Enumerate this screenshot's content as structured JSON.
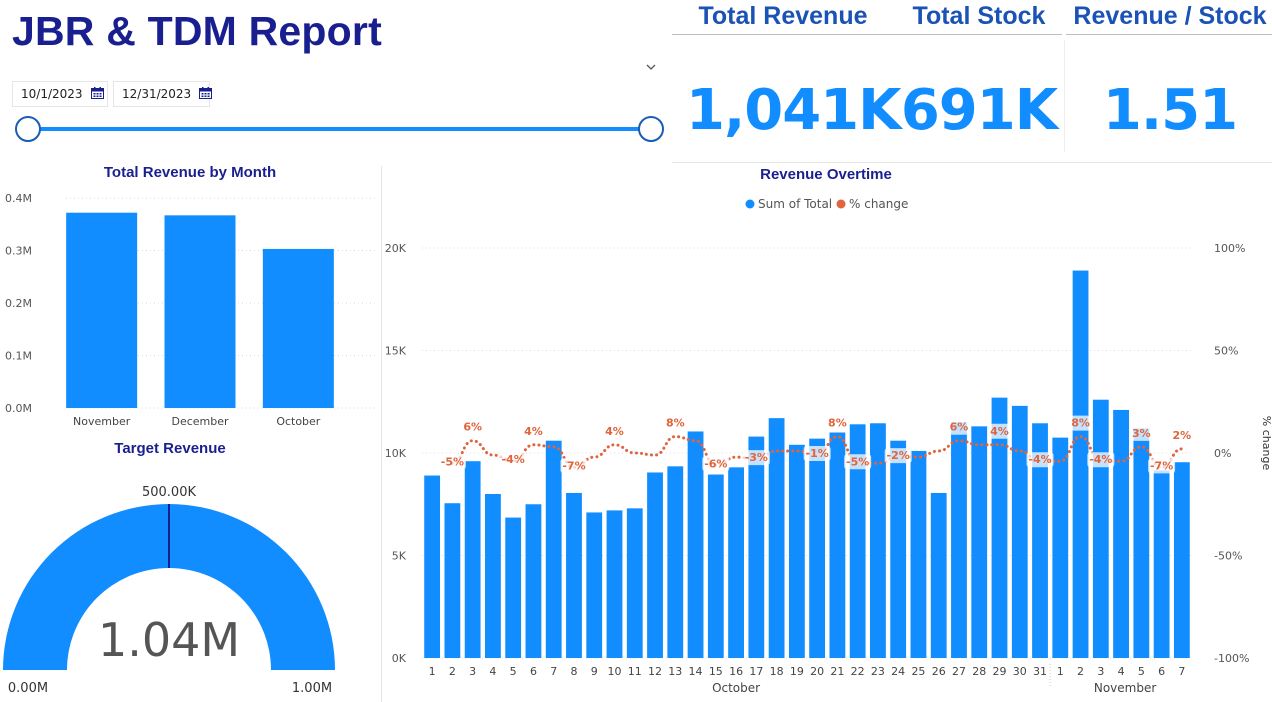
{
  "report": {
    "title": "JBR & TDM Report",
    "date_start": "10/1/2023",
    "date_end": "12/31/2023"
  },
  "icons": {
    "calendar": "calendar-icon",
    "chevron": "chevron-down-icon"
  },
  "colors": {
    "title": "#1a1f8f",
    "kpi_header": "#1a52b5",
    "accent": "#118dff",
    "change_line": "#e0643c"
  },
  "kpis": [
    {
      "label": "Total Revenue",
      "value": "1,041K"
    },
    {
      "label": "Total Stock",
      "value": "691K"
    },
    {
      "label": "Revenue / Stock",
      "value": "1.51"
    }
  ],
  "monthly": {
    "title": "Total Revenue by Month"
  },
  "gauge": {
    "title": "Target Revenue",
    "value_label": "1.04M",
    "min_label": "0.00M",
    "max_label": "1.00M",
    "target_label": "500.00K",
    "value": 1.04,
    "min": 0,
    "max": 1.0,
    "target": 0.5
  },
  "overtime": {
    "title": "Revenue Overtime"
  },
  "chart_data": [
    {
      "type": "bar",
      "title": "Total Revenue by Month",
      "categories": [
        "November",
        "December",
        "October"
      ],
      "values": [
        0.372,
        0.367,
        0.303
      ],
      "y_ticks": [
        "0.0M",
        "0.1M",
        "0.2M",
        "0.3M",
        "0.4M"
      ],
      "ylim": [
        0,
        0.4
      ],
      "grid": true
    },
    {
      "type": "bar",
      "title": "Revenue Overtime",
      "legend": [
        "Sum of Total",
        "% change"
      ],
      "legend_position": "top-center",
      "x_days": [
        "1",
        "2",
        "3",
        "4",
        "5",
        "6",
        "7",
        "8",
        "9",
        "10",
        "11",
        "12",
        "13",
        "14",
        "15",
        "16",
        "17",
        "18",
        "19",
        "20",
        "21",
        "22",
        "23",
        "24",
        "25",
        "26",
        "27",
        "28",
        "29",
        "30",
        "31",
        "1",
        "2",
        "3",
        "4",
        "5",
        "6",
        "7"
      ],
      "month_labels": [
        "October",
        "November"
      ],
      "series": [
        {
          "name": "Sum of Total",
          "axis": "left",
          "values": [
            8900,
            7550,
            9600,
            8000,
            6850,
            7500,
            10600,
            8050,
            7100,
            7200,
            7300,
            9050,
            9350,
            11050,
            8950,
            9300,
            10800,
            11700,
            10400,
            10700,
            11000,
            11400,
            11450,
            10600,
            10100,
            8050,
            11500,
            11300,
            12700,
            12300,
            11450,
            10750,
            18900,
            12600,
            12100,
            11200,
            9150,
            9550
          ]
        },
        {
          "name": "% change",
          "type": "line",
          "axis": "right",
          "values": [
            null,
            -5,
            6,
            -1,
            -4,
            4,
            3,
            -7,
            -2,
            4,
            0,
            -1,
            8,
            6,
            -6,
            -2,
            -3,
            1,
            1,
            -1,
            8,
            -5,
            -5,
            -2,
            -2,
            1,
            6,
            4,
            4,
            1,
            -4,
            -4,
            8,
            -4,
            -4,
            3,
            -7,
            2
          ]
        }
      ],
      "data_labels": [
        "",
        "-5%",
        "6%",
        "",
        "-4%",
        "4%",
        "",
        "-7%",
        "",
        "4%",
        "",
        "",
        "8%",
        "",
        "-6%",
        "",
        "-3%",
        "",
        "",
        "-1%",
        "8%",
        "-5%",
        "",
        "-2%",
        "",
        "",
        "6%",
        "",
        "4%",
        "",
        "-4%",
        "",
        "8%",
        "-4%",
        "",
        "3%",
        "-7%",
        "2%"
      ],
      "y_left_ticks": [
        "0K",
        "5K",
        "10K",
        "15K",
        "20K"
      ],
      "y_left_lim": [
        0,
        20000
      ],
      "y_right_ticks": [
        "-100%",
        "-50%",
        "0%",
        "50%",
        "100%"
      ],
      "y_right_lim": [
        -100,
        100
      ],
      "y_right_label": "% change",
      "grid": true
    }
  ]
}
